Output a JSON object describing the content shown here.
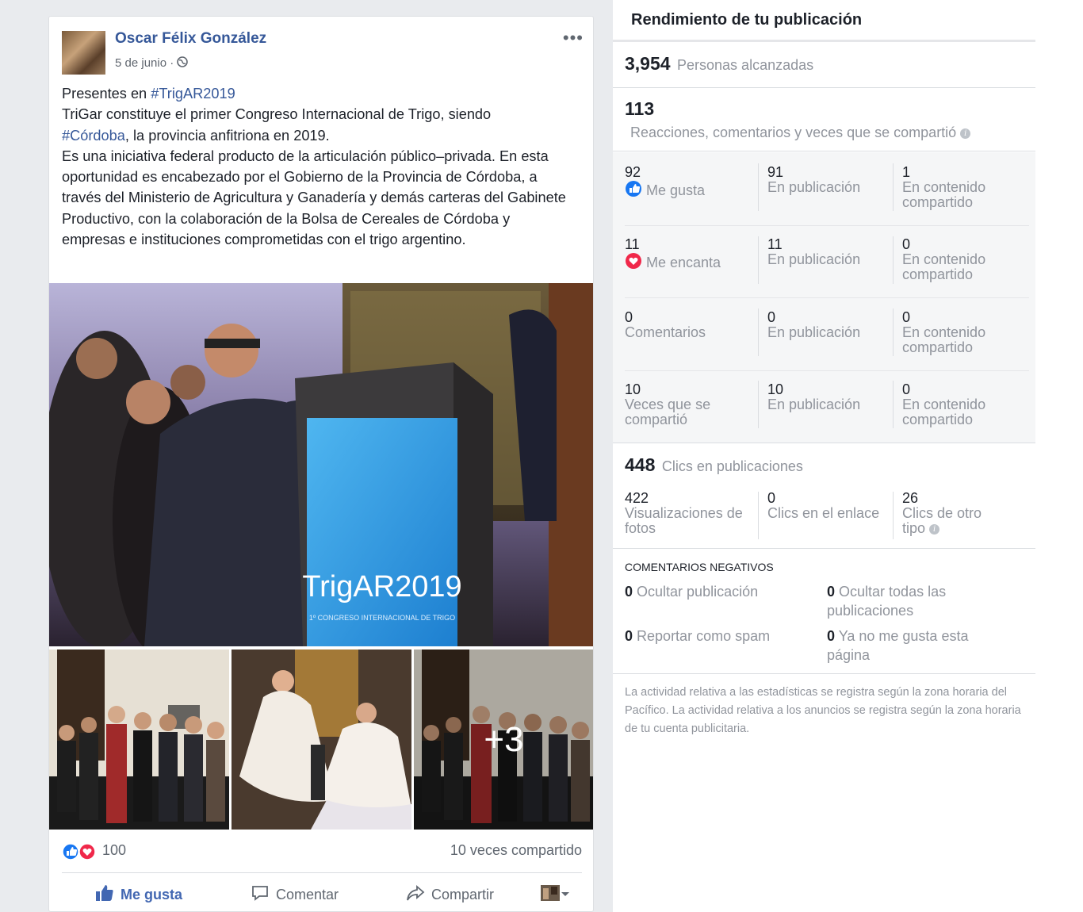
{
  "post": {
    "author": "Oscar Félix González",
    "date": "5 de junio · ",
    "more_label": "•••",
    "text_intro": "Presentes en ",
    "hashtag1": "#TrigAR2019",
    "line2": "TriGar constituye el primer Congreso Internacional de Trigo, siendo",
    "hashtag2": "#Córdoba",
    "line3": ", la provincia anfitriona en 2019.",
    "paragraph": "Es una iniciativa federal producto de la articulación público–privada. En esta oportunidad es encabezado por el Gobierno de la Provincia de Córdoba, a través del Ministerio de Agricultura y Ganadería y demás carteras del Gabinete Productivo, con la colaboración de la Bolsa de Cereales de Córdoba y empresas e instituciones comprometidas con el trigo argentino.",
    "photo_sign_text": "TrigAR2019",
    "photo_sign_sub": "1º CONGRESO INTERNACIONAL DE TRIGO",
    "more_photos": "+3",
    "reactions_count": "100",
    "shares": "10 veces compartido",
    "actions": {
      "like": "Me gusta",
      "comment": "Comentar",
      "share": "Compartir"
    }
  },
  "panel": {
    "title": "Rendimiento de tu publicación",
    "reach_value": "3,954",
    "reach_label": "Personas alcanzadas",
    "engagement_value": "113",
    "engagement_label": "Reacciones, comentarios y veces que se compartió",
    "rows": [
      {
        "n1": "92",
        "l1": "Me gusta",
        "n2": "91",
        "l2": "En publicación",
        "n3": "1",
        "l3": "En contenido compartido"
      },
      {
        "n1": "11",
        "l1": "Me encanta",
        "n2": "11",
        "l2": "En publicación",
        "n3": "0",
        "l3": "En contenido compartido"
      },
      {
        "n1": "0",
        "l1": "Comentarios",
        "n2": "0",
        "l2": "En publicación",
        "n3": "0",
        "l3": "En contenido compartido"
      },
      {
        "n1": "10",
        "l1": "Veces que se compartió",
        "n2": "10",
        "l2": "En publicación",
        "n3": "0",
        "l3": "En contenido compartido"
      }
    ],
    "clicks_value": "448",
    "clicks_label": "Clics en publicaciones",
    "clicks": [
      {
        "n": "422",
        "l": "Visualizaciones de fotos"
      },
      {
        "n": "0",
        "l": "Clics en el enlace"
      },
      {
        "n": "26",
        "l": "Clics de otro tipo"
      }
    ],
    "negative_title": "COMENTARIOS NEGATIVOS",
    "negative": [
      {
        "n": "0",
        "l": "Ocultar publicación"
      },
      {
        "n": "0",
        "l": "Ocultar todas las publicaciones"
      },
      {
        "n": "0",
        "l": "Reportar como spam"
      },
      {
        "n": "0",
        "l": "Ya no me gusta esta página"
      }
    ],
    "footnote": "La actividad relativa a las estadísticas se registra según la zona horaria del Pacífico. La actividad relativa a los anuncios se registra según la zona horaria de tu cuenta publicitaria.",
    "info_icon": "i"
  },
  "colors": {
    "link": "#365899",
    "like_blue": "#1877f2",
    "love_red": "#f0284a",
    "muted": "#90949c"
  }
}
